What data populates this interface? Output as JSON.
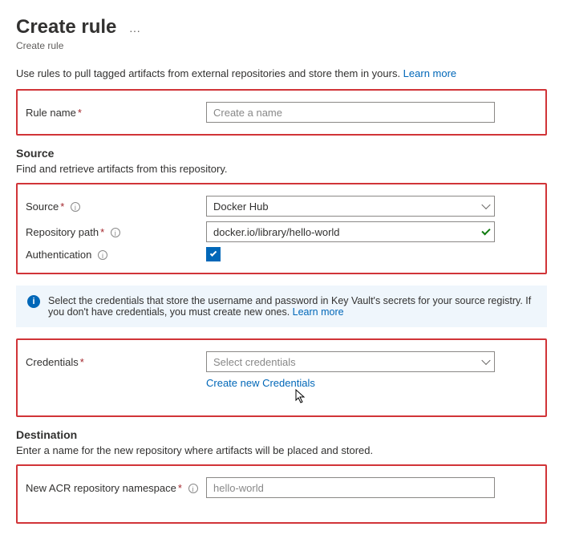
{
  "header": {
    "title": "Create rule",
    "breadcrumb": "Create rule"
  },
  "intro": {
    "text": "Use rules to pull tagged artifacts from external repositories and store them in yours. ",
    "learn_more": "Learn more"
  },
  "rule": {
    "label": "Rule name",
    "placeholder": "Create a name"
  },
  "source": {
    "heading": "Source",
    "subtext": "Find and retrieve artifacts from this repository.",
    "source_label": "Source",
    "source_value": "Docker Hub",
    "repo_label": "Repository path",
    "repo_value": "docker.io/library/hello-world",
    "auth_label": "Authentication"
  },
  "banner": {
    "text": "Select the credentials that store the username and password in Key Vault's secrets for your source registry. If you don't have credentials, you must create new ones. ",
    "learn_more": "Learn more"
  },
  "credentials": {
    "label": "Credentials",
    "placeholder": "Select credentials",
    "create_link": "Create new Credentials"
  },
  "destination": {
    "heading": "Destination",
    "subtext": "Enter a name for the new repository where artifacts will be placed and stored.",
    "ns_label": "New ACR repository namespace",
    "ns_value": "hello-world"
  }
}
